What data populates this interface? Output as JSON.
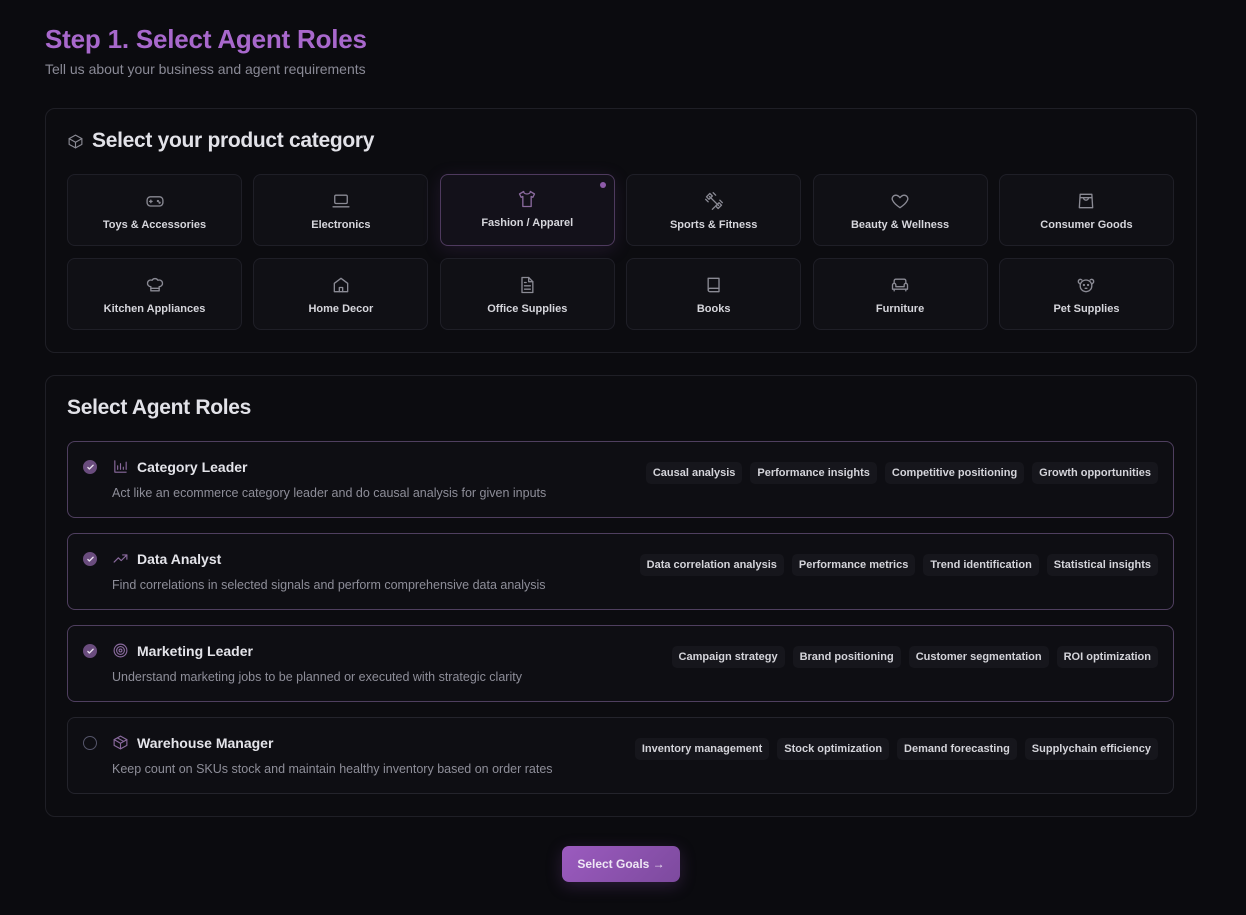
{
  "header": {
    "title": "Step 1. Select Agent Roles",
    "subtitle": "Tell us about your business and agent requirements"
  },
  "category_section": {
    "title": "Select your product category",
    "icon": "box-icon",
    "selected": "Fashion / Apparel",
    "items": [
      {
        "label": "Toys & Accessories",
        "icon": "gamepad-icon"
      },
      {
        "label": "Electronics",
        "icon": "laptop-icon"
      },
      {
        "label": "Fashion / Apparel",
        "icon": "shirt-icon"
      },
      {
        "label": "Sports & Fitness",
        "icon": "dumbbell-icon"
      },
      {
        "label": "Beauty & Wellness",
        "icon": "heart-icon"
      },
      {
        "label": "Consumer Goods",
        "icon": "shopping-bag-icon"
      },
      {
        "label": "Kitchen Appliances",
        "icon": "chef-hat-icon"
      },
      {
        "label": "Home Decor",
        "icon": "home-icon"
      },
      {
        "label": "Office Supplies",
        "icon": "file-text-icon"
      },
      {
        "label": "Books",
        "icon": "book-icon"
      },
      {
        "label": "Furniture",
        "icon": "sofa-icon"
      },
      {
        "label": "Pet Supplies",
        "icon": "pet-icon"
      }
    ]
  },
  "roles_section": {
    "title": "Select Agent Roles",
    "roles": [
      {
        "name": "Category Leader",
        "icon": "bar-chart-icon",
        "checked": true,
        "description": "Act like an ecommerce category leader and do causal analysis for given inputs",
        "tags": [
          "Causal analysis",
          "Performance insights",
          "Competitive positioning",
          "Growth opportunities"
        ]
      },
      {
        "name": "Data Analyst",
        "icon": "trending-up-icon",
        "checked": true,
        "description": "Find correlations in selected signals and perform comprehensive data analysis",
        "tags": [
          "Data correlation analysis",
          "Performance metrics",
          "Trend identification",
          "Statistical insights"
        ]
      },
      {
        "name": "Marketing Leader",
        "icon": "target-icon",
        "checked": true,
        "description": "Understand marketing jobs to be planned or executed with strategic clarity",
        "tags": [
          "Campaign strategy",
          "Brand positioning",
          "Customer segmentation",
          "ROI optimization"
        ]
      },
      {
        "name": "Warehouse Manager",
        "icon": "package-icon",
        "checked": false,
        "description": "Keep count on SKUs stock and maintain healthy inventory based on order rates",
        "tags": [
          "Inventory management",
          "Stock optimization",
          "Demand forecasting",
          "Supplychain efficiency"
        ]
      }
    ]
  },
  "cta": {
    "label": "Select Goals →"
  },
  "colors": {
    "accent": "#a868cc",
    "background": "#0b0b0f",
    "checked": "#6a4c7e"
  }
}
